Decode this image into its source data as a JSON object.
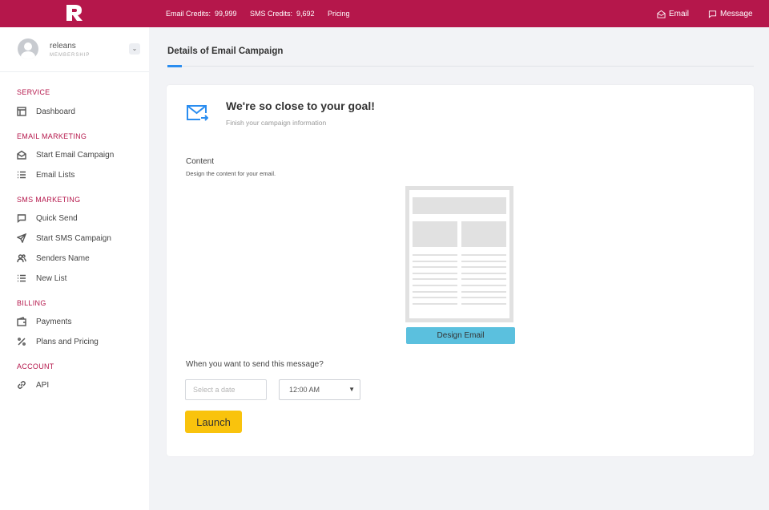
{
  "topbar": {
    "email_credits_label": "Email Credits:",
    "email_credits_value": "99,999",
    "sms_credits_label": "SMS Credits:",
    "sms_credits_value": "9,692",
    "pricing_label": "Pricing",
    "email_link": "Email",
    "message_link": "Message",
    "brand_color": "#b5174b"
  },
  "user": {
    "name": "releans",
    "role": "MEMBERSHIP"
  },
  "sidebar": {
    "sections": [
      {
        "title": "SERVICE",
        "items": [
          {
            "label": "Dashboard",
            "icon": "layout-icon"
          }
        ]
      },
      {
        "title": "EMAIL MARKETING",
        "items": [
          {
            "label": "Start Email Campaign",
            "icon": "mail-open-icon"
          },
          {
            "label": "Email Lists",
            "icon": "list-icon"
          }
        ]
      },
      {
        "title": "SMS MARKETING",
        "items": [
          {
            "label": "Quick Send",
            "icon": "chat-icon"
          },
          {
            "label": "Start SMS Campaign",
            "icon": "send-icon"
          },
          {
            "label": "Senders Name",
            "icon": "users-icon"
          },
          {
            "label": "New List",
            "icon": "list-icon"
          }
        ]
      },
      {
        "title": "BILLING",
        "items": [
          {
            "label": "Payments",
            "icon": "wallet-icon"
          },
          {
            "label": "Plans and Pricing",
            "icon": "percent-icon"
          }
        ]
      },
      {
        "title": "ACCOUNT",
        "items": [
          {
            "label": "API",
            "icon": "link-icon"
          }
        ]
      }
    ]
  },
  "main": {
    "page_title": "Details of Email Campaign",
    "goal_title": "We're so close to your goal!",
    "goal_subtitle": "Finish your campaign information",
    "content_label": "Content",
    "content_subtitle": "Design the content for your email.",
    "design_button": "Design Email",
    "when_label": "When you want to send this message?",
    "date_placeholder": "Select a date",
    "time_value": "12:00 AM",
    "launch_button": "Launch",
    "accent_color": "#2a8df0",
    "launch_color": "#f9c30d",
    "design_button_color": "#5bc0de"
  }
}
